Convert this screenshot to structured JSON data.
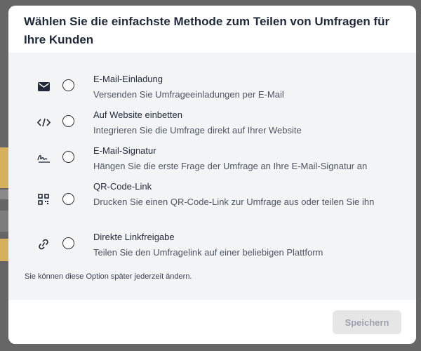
{
  "dialog": {
    "title": "Wählen Sie die einfachste Methode zum Teilen von Umfragen für Ihre Kunden",
    "hint": "Sie können diese Option später jederzeit ändern.",
    "save_label": "Speichern"
  },
  "options": [
    {
      "icon": "envelope-icon",
      "title": "E-Mail-Einladung",
      "description": "Versenden Sie Umfrageeinladungen per E-Mail"
    },
    {
      "icon": "code-icon",
      "title": "Auf Website einbetten",
      "description": "Integrieren Sie die Umfrage direkt auf Ihrer Website"
    },
    {
      "icon": "signature-icon",
      "title": "E-Mail-Signatur",
      "description": "Hängen Sie die erste Frage der Umfrage an Ihre E-Mail-Signatur an"
    },
    {
      "icon": "qr-code-icon",
      "title": "QR-Code-Link",
      "description": "Drucken Sie einen QR-Code-Link zur Umfrage aus oder teilen Sie ihn"
    },
    {
      "icon": "link-icon",
      "title": "Direkte Linkfreigabe",
      "description": "Teilen Sie den Umfragelink auf einer beliebigen Plattform"
    }
  ],
  "colors": {
    "accent_disabled": "#e6e6e6",
    "body_bg": "#f3f4f6"
  }
}
